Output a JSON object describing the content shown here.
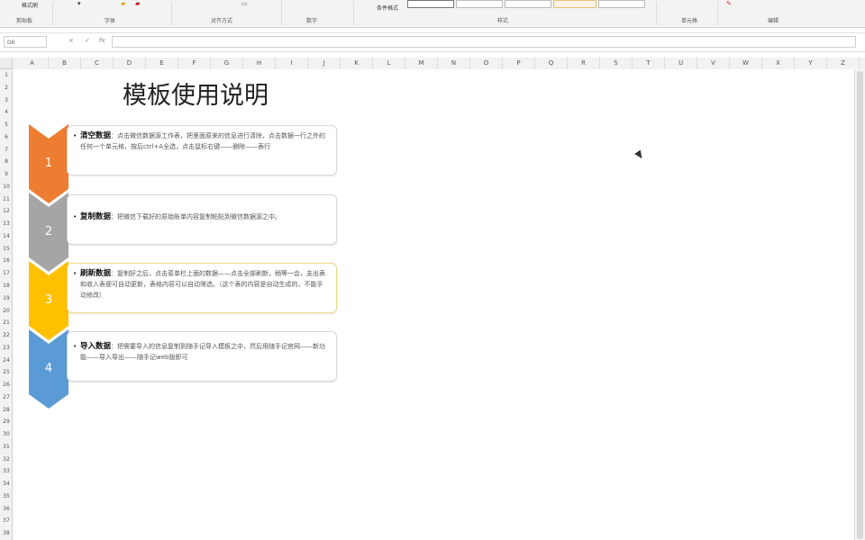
{
  "ribbon": {
    "top_labels": [
      "格式刷"
    ],
    "groups": [
      "剪贴板",
      "字体",
      "对齐方式",
      "数字",
      "样式",
      "单元格",
      "编辑"
    ],
    "cond_format_label": "条件格式"
  },
  "formula_bar": {
    "name_box": "D6",
    "cancel_symbol": "×",
    "enter_symbol": "✓",
    "fx_symbol": "fx",
    "value": ""
  },
  "columns": [
    "A",
    "B",
    "C",
    "D",
    "E",
    "F",
    "G",
    "H",
    "I",
    "J",
    "K",
    "L",
    "M",
    "N",
    "O",
    "P",
    "Q",
    "R",
    "S",
    "T",
    "U",
    "V",
    "W",
    "X",
    "Y",
    "Z"
  ],
  "rows": [
    "1",
    "2",
    "3",
    "4",
    "5",
    "6",
    "7",
    "8",
    "9",
    "10",
    "11",
    "12",
    "13",
    "14",
    "15",
    "16",
    "17",
    "18",
    "19",
    "20",
    "21",
    "22",
    "23",
    "24",
    "25",
    "26",
    "27",
    "28",
    "29",
    "30",
    "31",
    "32",
    "33",
    "34",
    "35",
    "36",
    "37",
    "38"
  ],
  "doc": {
    "title": "模板使用说明",
    "steps": [
      {
        "number": "1",
        "color": "#ED7D31",
        "heading": "清空数据",
        "text": "：点击微信数据源工作表，把里面原来的信息进行清除，点击数据一行之外的任何一个单元格，按后ctrl+A全选，点击鼠标右键——删除——表行"
      },
      {
        "number": "2",
        "color": "#A5A5A5",
        "heading": "复制数据",
        "text": "：把微信下载好的原始账单内容复制粘贴到微信数据源之中。"
      },
      {
        "number": "3",
        "color": "#FFC000",
        "heading": "刷新数据",
        "text": "：复制好之后，点击菜单栏上面的数据——点击全部刷新，稍等一会，支出表和收入表便可自动更新，表格内容可以自动筛选。（这个表的内容是自动生成的，不能手动修改）"
      },
      {
        "number": "4",
        "color": "#5B9BD5",
        "heading": "导入数据",
        "text": "：把需要导入的信息复制到随手记导入模板之中，然后用随手记官网——新功能——导入导出——随手记web版即可"
      }
    ]
  }
}
